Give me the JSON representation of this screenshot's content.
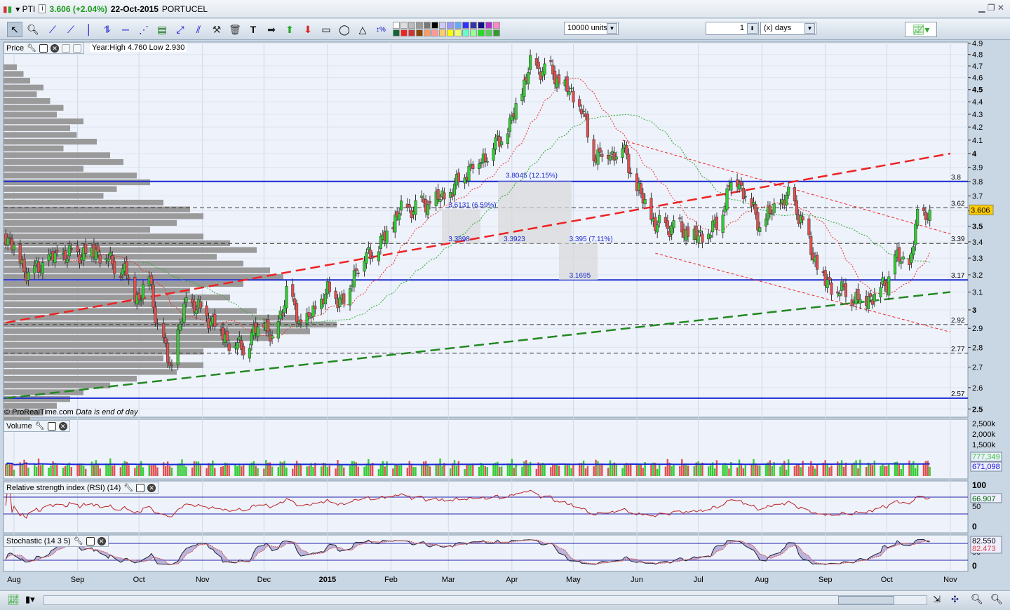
{
  "header": {
    "symbol": "PTI",
    "price_change": "3.606 (+2.04%)",
    "date": "22-Oct-2015",
    "name": "PORTUCEL"
  },
  "toolbar": {
    "units": "10000 units",
    "period_value": "1",
    "period_unit": "(x) days"
  },
  "colors": {
    "up": "#33cc33",
    "down": "#e05050",
    "accent": "#0000cc",
    "trend_red": "#ee2222",
    "trend_green": "#228822"
  },
  "price_panel": {
    "label": "Price",
    "info": "Year:High 4.760 Low 2.930",
    "footer_copyright": "© ProRealTime.com",
    "footer_note": "Data is end of day",
    "last_price": "3.606"
  },
  "volume_panel": {
    "label": "Volume",
    "ticks": [
      "2,500k",
      "2,000k",
      "1,500k"
    ],
    "last_volume": "777,349",
    "avg_volume": "671,098"
  },
  "rsi_panel": {
    "label": "Relative strength index (RSI) (14)",
    "ticks": [
      "100",
      "50",
      "0"
    ],
    "last": "66.907"
  },
  "stoch_panel": {
    "label": "Stochastic (14 3 5)",
    "ticks": [
      "50",
      "0"
    ],
    "k": "82.550",
    "d": "82.473"
  },
  "chart_data": {
    "type": "candlestick",
    "symbol": "PTI",
    "y_scale": "log",
    "ylim": [
      2.5,
      4.9
    ],
    "y_ticks": [
      "4.9",
      "4.8",
      "4.7",
      "4.6",
      "4.5",
      "4.4",
      "4.3",
      "4.2",
      "4.1",
      "4",
      "3.9",
      "3.8",
      "3.7",
      "3.6",
      "3.5",
      "3.4",
      "3.3",
      "3.2",
      "3.1",
      "3",
      "2.9",
      "2.8",
      "2.7",
      "2.6",
      "2.5"
    ],
    "x_ticks": [
      {
        "label": "Aug",
        "date": "2014-08-01"
      },
      {
        "label": "Sep",
        "date": "2014-09-01"
      },
      {
        "label": "Oct",
        "date": "2014-10-01"
      },
      {
        "label": "Nov",
        "date": "2014-11-01"
      },
      {
        "label": "Dec",
        "date": "2014-12-01"
      },
      {
        "label": "2015",
        "date": "2015-01-01"
      },
      {
        "label": "Feb",
        "date": "2015-02-01"
      },
      {
        "label": "Mar",
        "date": "2015-03-01"
      },
      {
        "label": "Apr",
        "date": "2015-04-01"
      },
      {
        "label": "May",
        "date": "2015-05-01"
      },
      {
        "label": "Jun",
        "date": "2015-06-01"
      },
      {
        "label": "Jul",
        "date": "2015-07-01"
      },
      {
        "label": "Aug",
        "date": "2015-08-01"
      },
      {
        "label": "Sep",
        "date": "2015-09-01"
      },
      {
        "label": "Oct",
        "date": "2015-10-01"
      },
      {
        "label": "Nov",
        "date": "2015-11-01"
      }
    ],
    "close_path": [
      [
        "2014-07-28",
        3.45
      ],
      [
        "2014-08-08",
        3.2
      ],
      [
        "2014-08-20",
        3.3
      ],
      [
        "2014-09-10",
        3.35
      ],
      [
        "2014-09-25",
        3.2
      ],
      [
        "2014-10-01",
        3.05
      ],
      [
        "2014-10-06",
        3.2
      ],
      [
        "2014-10-10",
        2.9
      ],
      [
        "2014-10-17",
        2.7
      ],
      [
        "2014-10-24",
        3.05
      ],
      [
        "2014-11-05",
        2.95
      ],
      [
        "2014-11-15",
        2.82
      ],
      [
        "2014-11-22",
        2.8
      ],
      [
        "2014-12-01",
        2.95
      ],
      [
        "2014-12-05",
        2.82
      ],
      [
        "2014-12-12",
        3.1
      ],
      [
        "2014-12-20",
        2.9
      ],
      [
        "2015-01-01",
        3.1
      ],
      [
        "2015-01-10",
        3.05
      ],
      [
        "2015-01-15",
        3.25
      ],
      [
        "2015-01-28",
        3.4
      ],
      [
        "2015-02-05",
        3.6
      ],
      [
        "2015-02-20",
        3.65
      ],
      [
        "2015-03-01",
        3.7
      ],
      [
        "2015-03-10",
        3.88
      ],
      [
        "2015-03-20",
        4.0
      ],
      [
        "2015-03-31",
        4.2
      ],
      [
        "2015-04-10",
        4.7
      ],
      [
        "2015-04-20",
        4.65
      ],
      [
        "2015-04-30",
        4.45
      ],
      [
        "2015-05-05",
        4.35
      ],
      [
        "2015-05-10",
        4.0
      ],
      [
        "2015-05-20",
        4.0
      ],
      [
        "2015-05-25",
        4.05
      ],
      [
        "2015-06-01",
        3.75
      ],
      [
        "2015-06-10",
        3.5
      ],
      [
        "2015-06-20",
        3.5
      ],
      [
        "2015-07-01",
        3.42
      ],
      [
        "2015-07-10",
        3.5
      ],
      [
        "2015-07-18",
        3.85
      ],
      [
        "2015-07-25",
        3.7
      ],
      [
        "2015-07-31",
        3.5
      ],
      [
        "2015-08-10",
        3.65
      ],
      [
        "2015-08-15",
        3.7
      ],
      [
        "2015-08-20",
        3.55
      ],
      [
        "2015-08-25",
        3.35
      ],
      [
        "2015-09-01",
        3.15
      ],
      [
        "2015-09-10",
        3.1
      ],
      [
        "2015-09-20",
        3.05
      ],
      [
        "2015-10-01",
        3.15
      ],
      [
        "2015-10-05",
        3.3
      ],
      [
        "2015-10-12",
        3.25
      ],
      [
        "2015-10-16",
        3.55
      ],
      [
        "2015-10-22",
        3.606
      ]
    ],
    "horizontal_lines": [
      {
        "value": 3.8,
        "label": "3.8",
        "style": "solid"
      },
      {
        "value": 3.62,
        "label": "3.62",
        "style": "dashed"
      },
      {
        "value": 3.39,
        "label": "3.39",
        "style": "dashed"
      },
      {
        "value": 3.17,
        "label": "3.17",
        "style": "solid"
      },
      {
        "value": 2.92,
        "label": "2.92",
        "style": "dashed"
      },
      {
        "value": 2.77,
        "label": "2.77",
        "style": "dashed"
      },
      {
        "value": 2.55,
        "label": "2.57",
        "style": "solid"
      }
    ],
    "trendlines": [
      {
        "color": "#ee2222",
        "style": "bold-dash",
        "from": [
          "2014-07-28",
          2.93
        ],
        "to": [
          "2015-11-01",
          4.0
        ]
      },
      {
        "color": "#228822",
        "style": "bold-dash",
        "from": [
          "2014-07-28",
          2.55
        ],
        "to": [
          "2015-11-01",
          3.1
        ]
      },
      {
        "color": "#ee2222",
        "style": "thin-dash",
        "from": [
          "2015-05-25",
          4.1
        ],
        "to": [
          "2015-11-01",
          3.45
        ]
      },
      {
        "color": "#ee2222",
        "style": "thin-dash",
        "from": [
          "2015-06-10",
          3.33
        ],
        "to": [
          "2015-11-01",
          2.88
        ]
      }
    ],
    "annotations": [
      {
        "text": "3.8045 (12.15%)",
        "date": "2015-03-29",
        "value": 3.81
      },
      {
        "text": "3.6131 (6.59%)",
        "date": "2015-03-01",
        "value": 3.61
      },
      {
        "text": "3.3898",
        "date": "2015-03-01",
        "value": 3.39
      },
      {
        "text": "3.3923",
        "date": "2015-03-28",
        "value": 3.39
      },
      {
        "text": "3.395 (7.11%)",
        "date": "2015-04-29",
        "value": 3.39
      },
      {
        "text": "3.1695",
        "date": "2015-04-29",
        "value": 3.17
      }
    ],
    "volume_profile": [
      2,
      3,
      4,
      6,
      5,
      7,
      9,
      8,
      12,
      10,
      11,
      14,
      9,
      16,
      18,
      12,
      20,
      22,
      17,
      15,
      24,
      28,
      30,
      26,
      22,
      30,
      34,
      38,
      32,
      36,
      40,
      42,
      36,
      28,
      34,
      30,
      38,
      44,
      50,
      46,
      40,
      36,
      30,
      24,
      30,
      26,
      20,
      16,
      12,
      10,
      8,
      6,
      4,
      3
    ]
  }
}
